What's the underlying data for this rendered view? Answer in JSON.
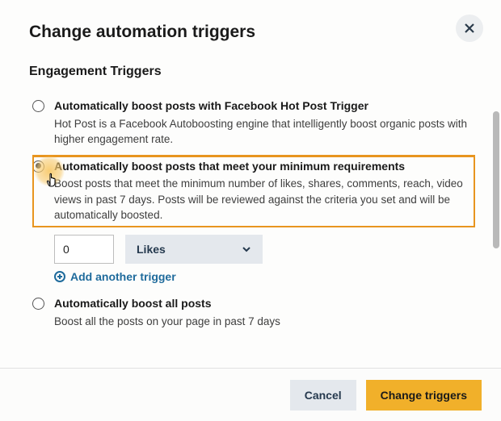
{
  "header": {
    "title": "Change automation triggers"
  },
  "section": {
    "title": "Engagement Triggers"
  },
  "options": [
    {
      "label": "Automatically boost posts with Facebook Hot Post Trigger",
      "description": "Hot Post is a Facebook Autoboosting engine that intelligently boost organic posts with higher engagement rate."
    },
    {
      "label": "Automatically boost posts that meet your minimum requirements",
      "description": "Boost posts that meet the minimum number of likes, shares, comments, reach, video views in past 7 days. Posts will be reviewed against the criteria you set and will be automatically boosted."
    },
    {
      "label": "Automatically boost all posts",
      "description": "Boost all the posts on your page in past 7 days"
    }
  ],
  "trigger": {
    "value": "0",
    "metric": "Likes",
    "add_label": "Add another trigger"
  },
  "footer": {
    "cancel": "Cancel",
    "submit": "Change triggers"
  }
}
